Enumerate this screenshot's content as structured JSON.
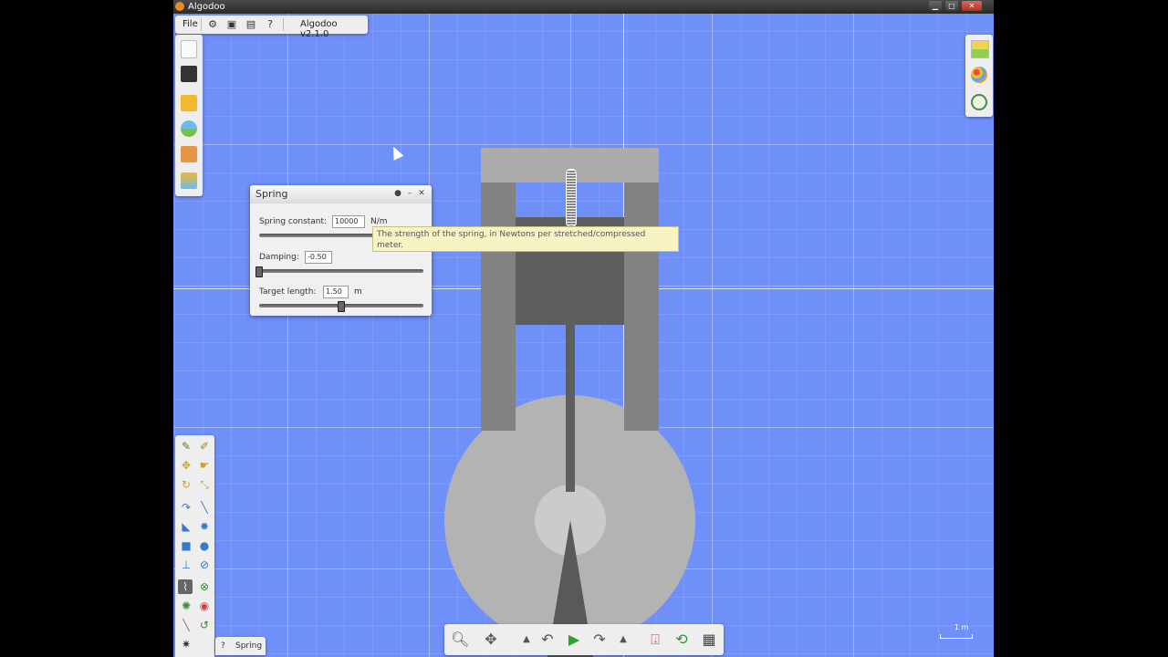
{
  "window": {
    "title": "Algodoo",
    "controls": {
      "minimize": "▁",
      "maximize": "□",
      "close": "✕"
    }
  },
  "menu": {
    "file_label": "File",
    "icons": [
      "gear-icon",
      "window-icon",
      "window-alt-icon",
      "help-icon"
    ],
    "help_glyph": "?",
    "version": "Algodoo v2.1.0"
  },
  "spring_panel": {
    "title": "Spring",
    "spring_constant": {
      "label": "Spring constant:",
      "value": "10000",
      "unit": "N/m"
    },
    "damping": {
      "label": "Damping:",
      "value": "-0.50",
      "slider_fraction": 0.0
    },
    "target_length": {
      "label": "Target length:",
      "value": "1.50",
      "unit": "m",
      "slider_fraction": 0.5
    }
  },
  "tooltip": {
    "text": "The strength of the spring, in Newtons per stretched/compressed meter."
  },
  "help_bar": {
    "glyph": "?",
    "label": "Spring"
  },
  "scale": {
    "label": "1 m"
  },
  "colors": {
    "canvas": "#6f8ff9",
    "panel": "#f0f0f0",
    "tooltip": "#f7f3c2",
    "play": "#2aa52a"
  }
}
